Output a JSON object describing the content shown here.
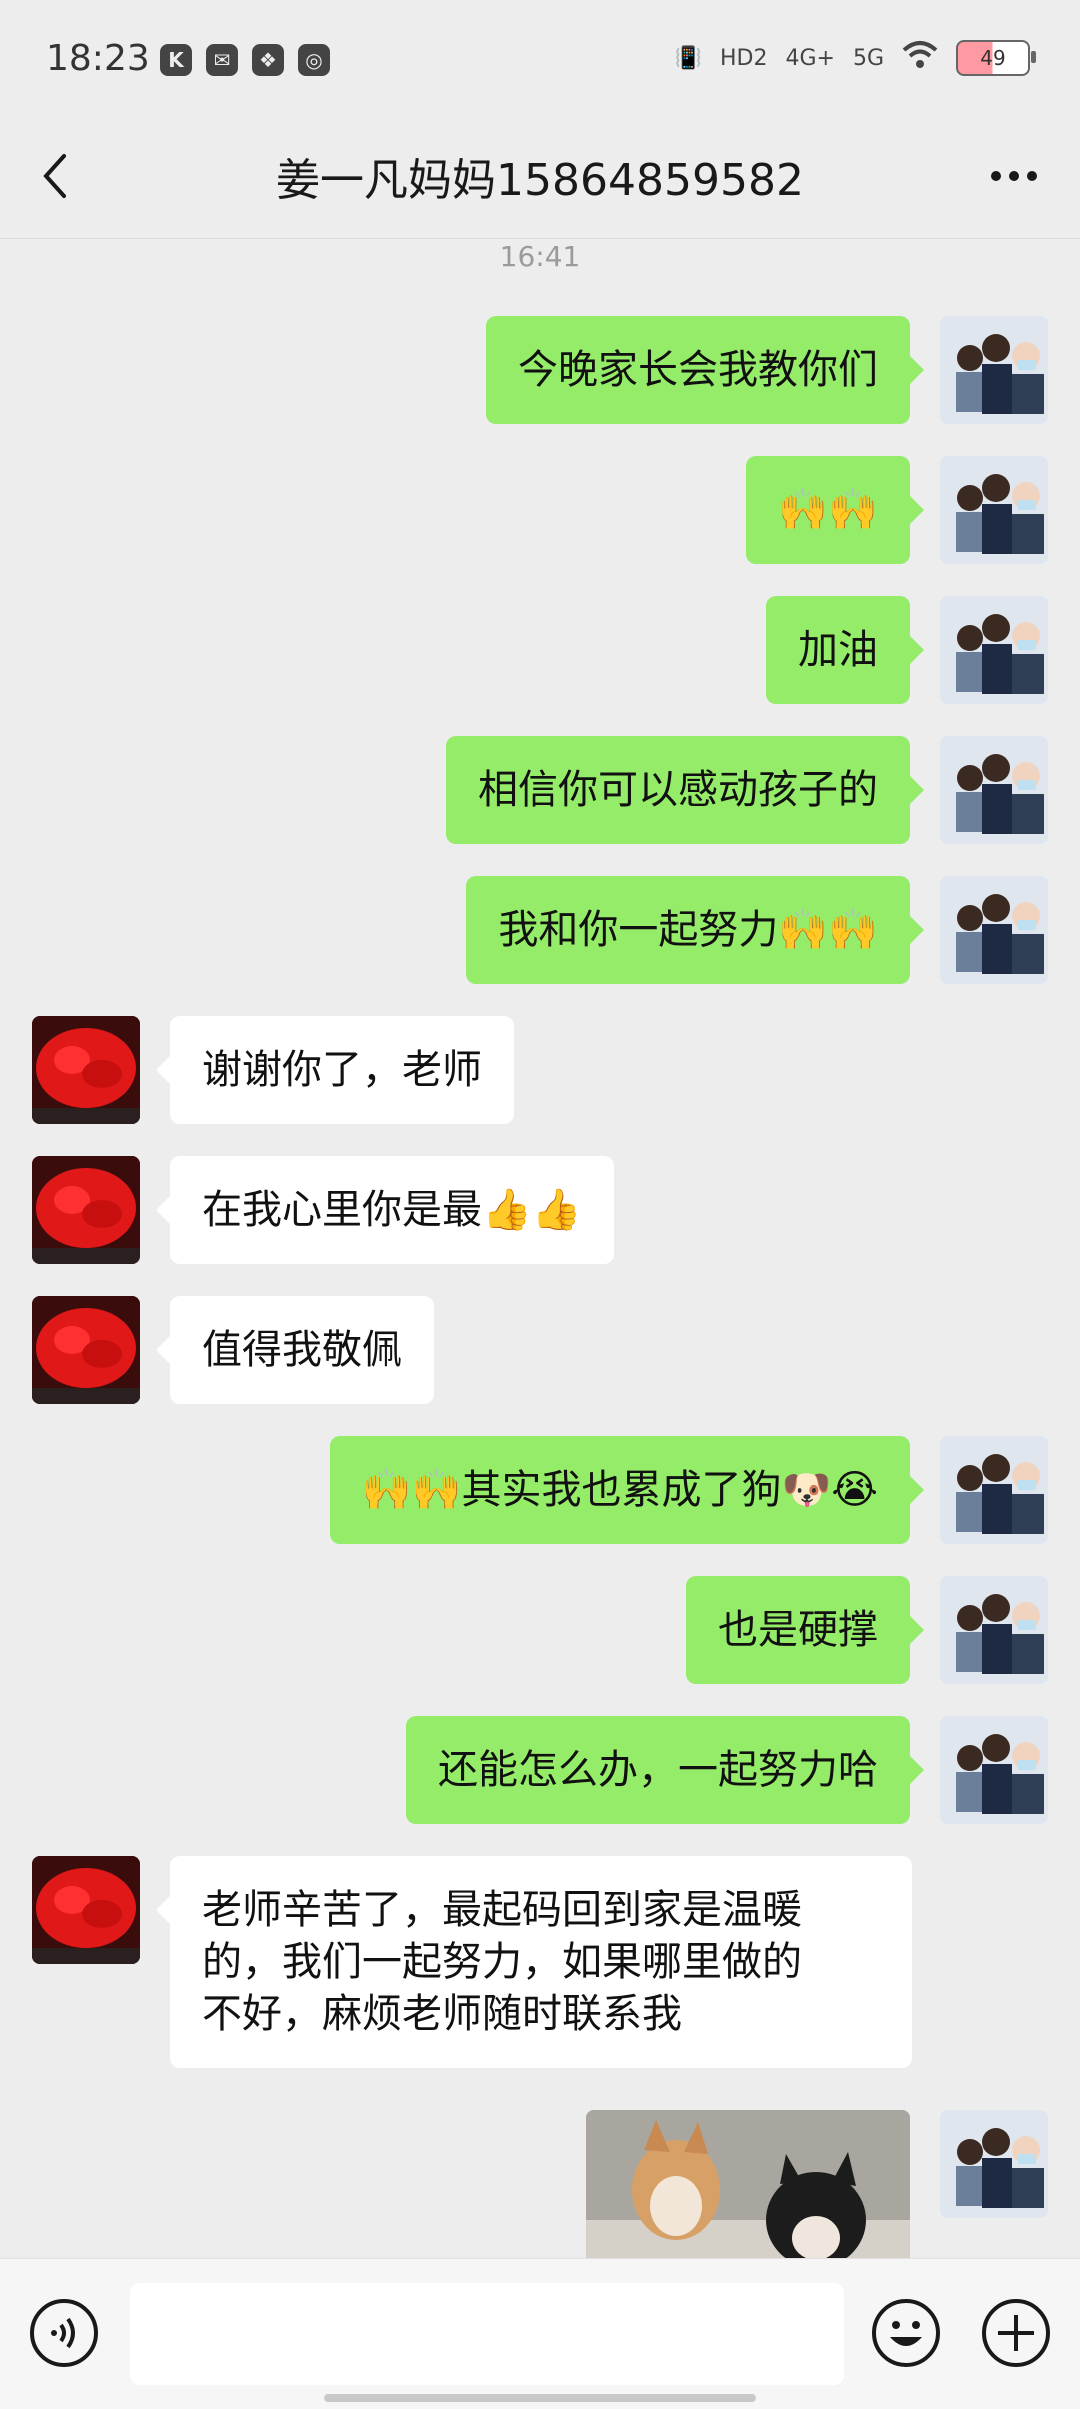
{
  "status_bar": {
    "time": "18:23",
    "app_icons": [
      "K",
      "✉",
      "❖",
      "◎"
    ],
    "indicators": [
      "HD2",
      "4G+",
      "5G"
    ],
    "battery": "49"
  },
  "header": {
    "title": "姜一凡妈妈15864859582"
  },
  "chat": {
    "timestamp": "16:41",
    "messages": [
      {
        "from": "me",
        "text": "今晚家长会我教你们"
      },
      {
        "from": "me",
        "text": "🙌🙌"
      },
      {
        "from": "me",
        "text": "加油"
      },
      {
        "from": "me",
        "text": "相信你可以感动孩子的"
      },
      {
        "from": "me",
        "text": "我和你一起努力🙌🙌"
      },
      {
        "from": "them",
        "text": "谢谢你了，老师"
      },
      {
        "from": "them",
        "text": "在我心里你是最👍👍"
      },
      {
        "from": "them",
        "text": "值得我敬佩"
      },
      {
        "from": "me",
        "text": "🙌🙌其实我也累成了狗🐶😭"
      },
      {
        "from": "me",
        "text": "也是硬撑"
      },
      {
        "from": "me",
        "text": "还能怎么办，一起努力哈"
      },
      {
        "from": "them",
        "text": "老师辛苦了，最起码回到家是温暖\n的，我们一起努力，如果哪里做的\n不好，麻烦老师随时联系我"
      },
      {
        "from": "me",
        "type": "image",
        "alt": "dogs photo"
      }
    ]
  },
  "input_bar": {
    "voice_icon": "voice-icon",
    "emoji_icon": "emoji-icon",
    "plus_icon": "plus-icon",
    "placeholder": ""
  },
  "colors": {
    "background": "#ededed",
    "my_bubble": "#95ec69",
    "their_bubble": "#ffffff"
  }
}
